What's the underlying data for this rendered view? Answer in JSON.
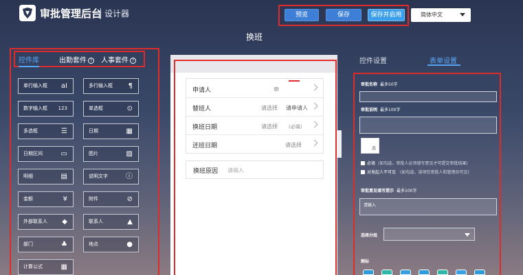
{
  "header": {
    "app_title": "审批管理后台",
    "section": "设计器",
    "buttons": {
      "preview": "预览",
      "save": "保存",
      "save_enable": "保存并启用"
    },
    "language": "简体中文"
  },
  "page_title": "换班",
  "left_panel": {
    "tabs": [
      "控件库",
      "出勤套件",
      "人事套件"
    ],
    "question_glyph": "?",
    "controls": [
      {
        "label": "单行输入框",
        "icon": "aI"
      },
      {
        "label": "多行输入框",
        "icon": "¶"
      },
      {
        "label": "数字输入框",
        "icon": "123"
      },
      {
        "label": "单选框",
        "icon": "⊙"
      },
      {
        "label": "多选框",
        "icon": "☰"
      },
      {
        "label": "日期",
        "icon": "▦"
      },
      {
        "label": "日期区间",
        "icon": "▭"
      },
      {
        "label": "图片",
        "icon": "▨"
      },
      {
        "label": "明细",
        "icon": "▤"
      },
      {
        "label": "说明文字",
        "icon": "ⓘ"
      },
      {
        "label": "金额",
        "icon": "¥"
      },
      {
        "label": "附件",
        "icon": "⊘"
      },
      {
        "label": "外部联系人",
        "icon": "◆"
      },
      {
        "label": "联系人",
        "icon": "▲"
      },
      {
        "label": "部门",
        "icon": "♣"
      },
      {
        "label": "地点",
        "icon": "●"
      },
      {
        "label": "计算公式",
        "icon": "▦"
      }
    ]
  },
  "form": {
    "rows": [
      {
        "label": "申请人",
        "placeholder": "申"
      },
      {
        "label": "替班人",
        "placeholder": "请选择"
      },
      {
        "label": "换班日期",
        "placeholder": "请选择"
      },
      {
        "label": "还班日期",
        "placeholder": "请选择"
      }
    ],
    "reason_label": "换班原因",
    "reason_placeholder": "请输入",
    "floating_text_a": "请申请人",
    "floating_text_b": "(必填)"
  },
  "right_panel": {
    "tabs": [
      "控件设置",
      "表单设置"
    ],
    "approval_name_label": "审批名称",
    "approval_name_hint": "最多50字",
    "approval_desc_label": "审批说明",
    "approval_desc_hint": "最多100字",
    "chk_box_text": "选",
    "required_text": "必填",
    "required_hint": "(如勾选，审批人必须填写意见才可提交审批结果)",
    "hide_text": "对发起人不可见",
    "hide_hint": "(如勾选，该项仅审批人和管理员可见)",
    "opinion_label": "审批意见填写提示",
    "opinion_hint": "最多100字",
    "opinion_placeholder": "请输入",
    "group_label": "选择分组",
    "icon_label": "图标",
    "icon_colors": [
      "#2f9bd8",
      "#2fb8a8",
      "#3aa0e0",
      "#2f9bd8",
      "#2fb8a8",
      "#3aa0e0",
      "#2f9bd8",
      "#2fb8a8"
    ]
  }
}
